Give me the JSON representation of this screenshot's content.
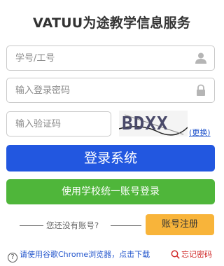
{
  "header": {
    "title": "VATUU为途教学信息服务"
  },
  "form": {
    "username_placeholder": "学号/工号",
    "password_placeholder": "输入登录密码",
    "captcha_placeholder": "输入验证码",
    "captcha_text": "BDXX",
    "refresh_label": "(更换)",
    "user_icon": "user-icon",
    "lock_icon": "lock-icon"
  },
  "buttons": {
    "login": "登录系统",
    "unified_login": "使用学校统一账号登录",
    "register": "账号注册"
  },
  "register_prompt": "您还没有账号?",
  "footer": {
    "help_text": "请使用谷歌Chrome浏览器，点击下载",
    "forgot_password": "忘记密码"
  },
  "colors": {
    "login_button": "#2257e0",
    "unified_button": "#4fb63a",
    "register_button": "#f8b43a",
    "link": "#2255cc",
    "forgot": "#d02a2a"
  }
}
